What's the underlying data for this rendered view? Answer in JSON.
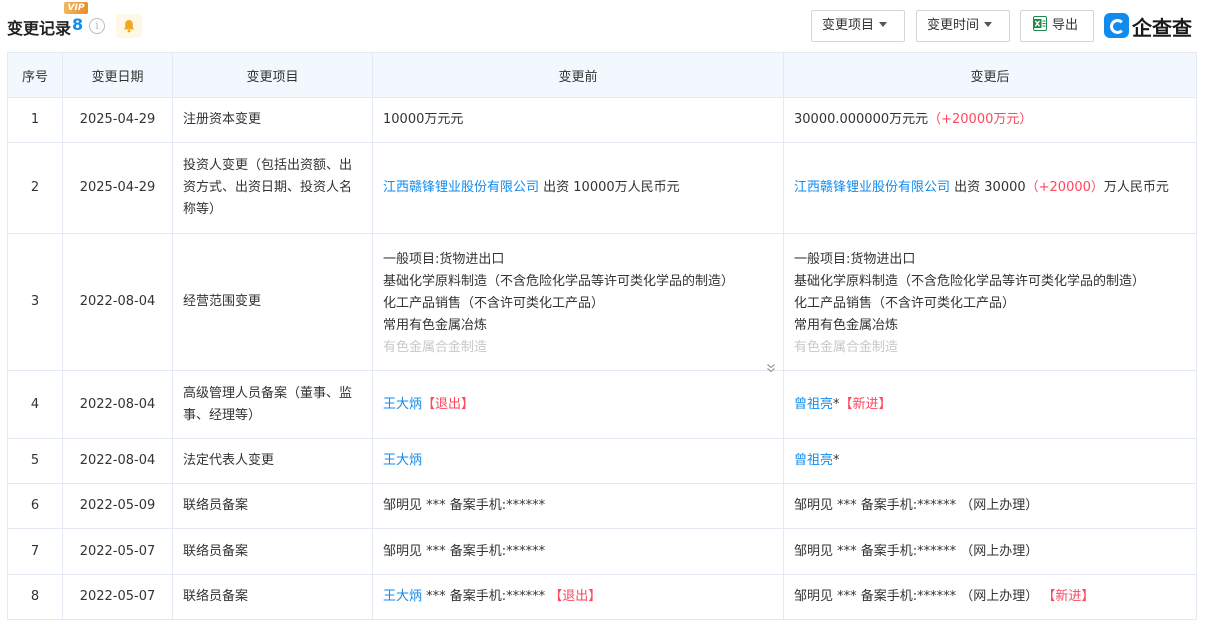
{
  "header": {
    "title": "变更记录",
    "count": "8",
    "vip_badge": "VIP",
    "info_glyph": "i",
    "buttons": {
      "change_item": "变更项目",
      "change_time": "变更时间",
      "export": "导出"
    },
    "logo_text": "企查查",
    "icons": [
      "info-icon",
      "bell-icon",
      "caret-down-icon",
      "excel-icon",
      "qcc-logo-icon",
      "expand-down-icon"
    ]
  },
  "colors": {
    "accent": "#128bed",
    "red": "#fd485e",
    "header_bg": "#f2f8fe"
  },
  "table": {
    "columns": [
      "序号",
      "变更日期",
      "变更项目",
      "变更前",
      "变更后"
    ],
    "rows": [
      {
        "no": "1",
        "date": "2025-04-29",
        "item": "注册资本变更",
        "before_text": "10000万元元",
        "after_text": "30000.000000万元元",
        "after_delta": "（+20000万元）"
      },
      {
        "no": "2",
        "date": "2025-04-29",
        "item": "投资人变更（包括出资额、出资方式、出资日期、投资人名称等）",
        "before_company": "江西赣锋锂业股份有限公司",
        "before_text": " 出资 10000万人民币元",
        "after_company": "江西赣锋锂业股份有限公司",
        "after_text_1": " 出资 30000",
        "after_delta": "（+20000）",
        "after_text_2": "万人民币元"
      },
      {
        "no": "3",
        "date": "2022-08-04",
        "item": "经营范围变更",
        "before_lines": [
          "一般项目:货物进出口",
          "基础化学原料制造（不含危险化学品等许可类化学品的制造）",
          "化工产品销售（不含许可类化工产品）",
          "常用有色金属冶炼",
          "有色金属合金制造"
        ],
        "after_lines": [
          "一般项目:货物进出口",
          "基础化学原料制造（不含危险化学品等许可类化学品的制造）",
          "化工产品销售（不含许可类化工产品）",
          "常用有色金属冶炼",
          "有色金属合金制造"
        ]
      },
      {
        "no": "4",
        "date": "2022-08-04",
        "item": "高级管理人员备案（董事、监事、经理等）",
        "before_name": "王大炳",
        "before_tag": "【退出】",
        "after_name": "曾祖亮",
        "after_star": "*",
        "after_tag": "【新进】"
      },
      {
        "no": "5",
        "date": "2022-08-04",
        "item": "法定代表人变更",
        "before_name": "王大炳",
        "after_name": "曾祖亮",
        "after_star": "*"
      },
      {
        "no": "6",
        "date": "2022-05-09",
        "item": "联络员备案",
        "before_text": "邹明见 *** 备案手机:******",
        "after_text": "邹明见 *** 备案手机:****** （网上办理）"
      },
      {
        "no": "7",
        "date": "2022-05-07",
        "item": "联络员备案",
        "before_text": "邹明见 *** 备案手机:******",
        "after_text": "邹明见 *** 备案手机:****** （网上办理）"
      },
      {
        "no": "8",
        "date": "2022-05-07",
        "item": "联络员备案",
        "before_name": "王大炳",
        "before_text": " *** 备案手机:****** ",
        "before_tag": "【退出】",
        "after_text": "邹明见 *** 备案手机:****** （网上办理）",
        "after_tag": "【新进】"
      }
    ]
  }
}
